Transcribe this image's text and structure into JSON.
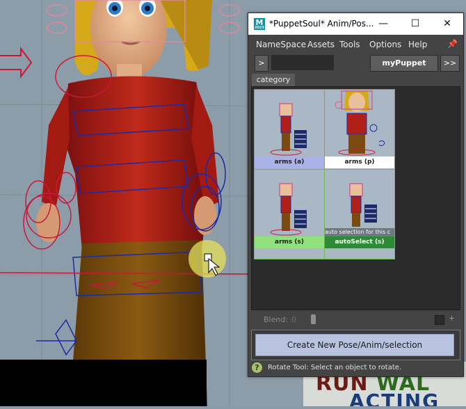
{
  "window": {
    "title": "*PuppetSoul* Anim/Pos...",
    "app_icon_letter": "M",
    "app_icon_sub": "2023"
  },
  "menus": [
    {
      "label": "NameSpace"
    },
    {
      "label": "Assets"
    },
    {
      "label": "Tools"
    },
    {
      "label": "Options"
    },
    {
      "label": "Help"
    }
  ],
  "toolbar": {
    "expand_label": ">",
    "puppet_name": "myPuppet",
    "more_label": ">>"
  },
  "tabs": [
    {
      "label": "category"
    }
  ],
  "tiles": [
    {
      "label": "arms (a)",
      "label_bg": "#a9b3ea",
      "label_color": "#1c1c1c",
      "border": "#8e8e8e",
      "caption": ""
    },
    {
      "label": "arms (p)",
      "label_bg": "#ffffff",
      "label_color": "#1c1c1c",
      "border": "#8e8e8e",
      "caption": ""
    },
    {
      "label": "arms (s)",
      "label_bg": "#90e07c",
      "label_color": "#1c1c1c",
      "border": "#6cbb52",
      "caption": ""
    },
    {
      "label": "autoSelect (s)",
      "label_bg": "#2d8a36",
      "label_color": "#ffffff",
      "border": "#6cbb52",
      "caption": "auto selection for this c"
    }
  ],
  "blend": {
    "label": "Blend:",
    "value": "0",
    "plus": "+"
  },
  "create_button": {
    "label": "Create New Pose/Anim/selection"
  },
  "status": {
    "text": "Rotate Tool: Select an object to rotate."
  },
  "poster": {
    "word1": "RUN",
    "word2": "WAL",
    "word3": "ACTING"
  }
}
